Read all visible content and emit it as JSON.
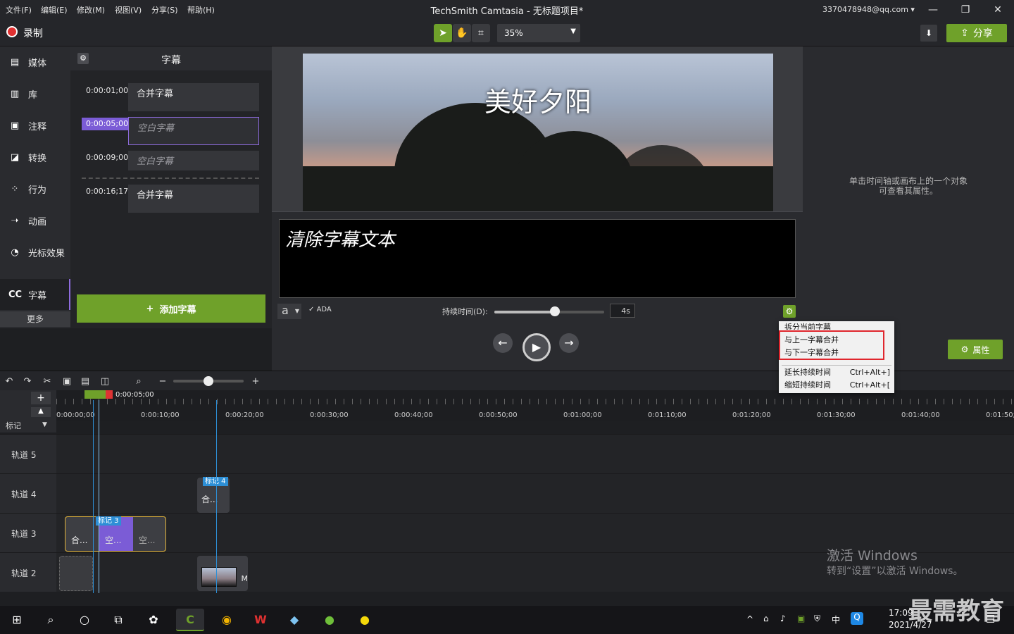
{
  "menu": [
    "文件(F)",
    "编辑(E)",
    "修改(M)",
    "视图(V)",
    "分享(S)",
    "帮助(H)"
  ],
  "app_title": "TechSmith Camtasia - 无标题项目*",
  "account": "3370478948@qq.com ▾",
  "window_controls": {
    "minimize": "—",
    "maximize": "❐",
    "close": "✕"
  },
  "toolbar": {
    "record_label": "录制",
    "zoom": "35%",
    "share_label": "分享"
  },
  "nav": [
    {
      "label": "媒体",
      "icon": "media-icon"
    },
    {
      "label": "库",
      "icon": "library-icon"
    },
    {
      "label": "注释",
      "icon": "annotation-icon"
    },
    {
      "label": "转换",
      "icon": "transition-icon"
    },
    {
      "label": "行为",
      "icon": "behavior-icon"
    },
    {
      "label": "动画",
      "icon": "animation-icon"
    },
    {
      "label": "光标效果",
      "icon": "cursor-effect-icon"
    },
    {
      "label": "字幕",
      "icon": "cc-icon"
    }
  ],
  "nav_more": "更多",
  "captions_panel": {
    "title": "字幕",
    "items": [
      {
        "time": "0:00:01;00",
        "text": "合并字幕",
        "empty": false,
        "selected": false
      },
      {
        "time": "0:00:05;00",
        "text": "空白字幕",
        "empty": true,
        "selected": true
      },
      {
        "time": "0:00:09;00",
        "text": "空白字幕",
        "empty": true,
        "selected": false
      },
      {
        "time": "0:00:16;17",
        "text": "合并字幕",
        "empty": false,
        "selected": false
      }
    ],
    "add_button": "添加字幕"
  },
  "canvas": {
    "video_caption": "美好夕阳"
  },
  "editor": {
    "text": "清除字幕文本",
    "font_button": "a",
    "ada_label": "ADA",
    "duration_label": "持续时间(D):",
    "duration_value": "4s",
    "duration_fraction": 0.55
  },
  "properties": {
    "hint_line1": "单击时间轴或画布上的一个对象",
    "hint_line2": "可查看其属性。",
    "button": "属性"
  },
  "context_menu": {
    "items": [
      {
        "label": "拆分当前字幕",
        "shortcut": ""
      },
      {
        "label": "与上一字幕合并",
        "shortcut": ""
      },
      {
        "label": "与下一字幕合并",
        "shortcut": ""
      },
      {
        "label": "延长持续时间",
        "shortcut": "Ctrl+Alt+]"
      },
      {
        "label": "缩短持续时间",
        "shortcut": "Ctrl+Alt+["
      }
    ]
  },
  "timeline": {
    "playhead_time": "0:00:05;00",
    "marker_label": "标记",
    "ticks": [
      "0:00:00;00",
      "0:00:10;00",
      "0:00:20;00",
      "0:00:30;00",
      "0:00:40;00",
      "0:00:50;00",
      "0:01:00;00",
      "0:01:10;00",
      "0:01:20;00",
      "0:01:30;00",
      "0:01:40;00",
      "0:01:50;"
    ],
    "tracks": [
      "轨道 5",
      "轨道 4",
      "轨道 3",
      "轨道 2"
    ],
    "markers": [
      "标记 4",
      "标记 3"
    ],
    "clips": {
      "track4": "合...",
      "track3": [
        "合...",
        "空...",
        "空..."
      ],
      "track2_label": "M"
    }
  },
  "watermark": {
    "line1": "激活 Windows",
    "line2": "转到“设置”以激活 Windows。"
  },
  "taskbar": {
    "time": "17:09",
    "date": "2021/4/27",
    "ime": "中",
    "logo": "最需教育"
  }
}
